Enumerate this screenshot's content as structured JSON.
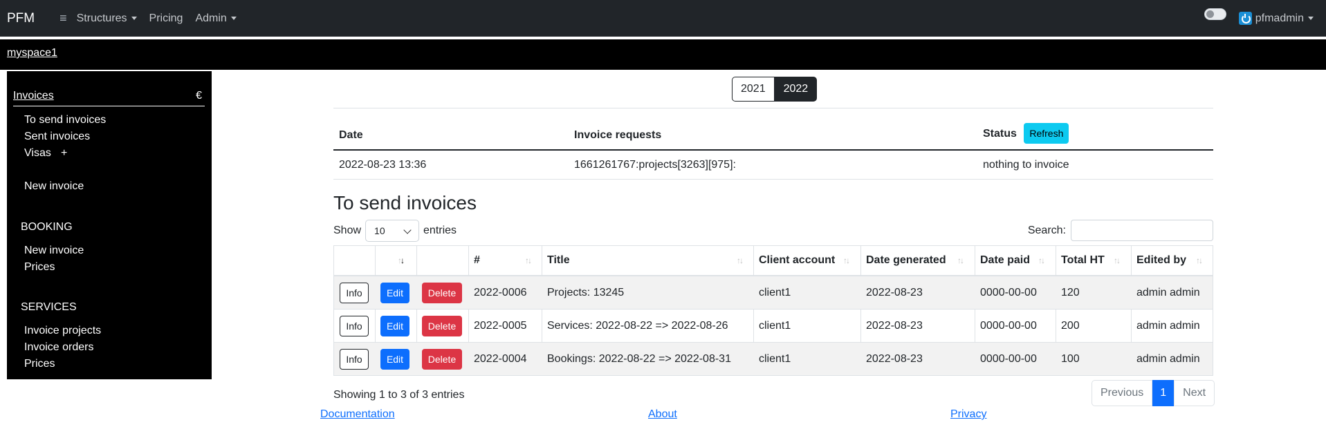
{
  "navbar": {
    "brand": "PFM",
    "menu": [
      {
        "label": "Structures",
        "dropdown": true
      },
      {
        "label": "Pricing",
        "dropdown": false
      },
      {
        "label": "Admin",
        "dropdown": true
      }
    ],
    "user": "pfmadmin"
  },
  "space": {
    "name": "myspace1"
  },
  "sidebar": {
    "title": "Invoices",
    "currency": "€",
    "invoice_items": [
      "To send invoices",
      "Sent invoices",
      "Visas"
    ],
    "visas_plus": "+",
    "new_invoice": "New invoice",
    "sections": [
      {
        "title": "BOOKING",
        "items": [
          "New invoice",
          "Prices"
        ]
      },
      {
        "title": "SERVICES",
        "items": [
          "Invoice projects",
          "Invoice orders",
          "Prices"
        ]
      }
    ]
  },
  "years": {
    "options": [
      "2021",
      "2022"
    ],
    "selected": "2022"
  },
  "requests": {
    "headers": {
      "date": "Date",
      "requests": "Invoice requests",
      "status": "Status"
    },
    "refresh_label": "Refresh",
    "rows": [
      {
        "date": "2022-08-23 13:36",
        "request": "1661261767:projects[3263][975]:",
        "status": "nothing to invoice"
      }
    ]
  },
  "invoices": {
    "title": "To send invoices",
    "show_label": "Show",
    "entries_label": "entries",
    "page_size": "10",
    "search_label": "Search:",
    "search_value": "",
    "columns": [
      "#",
      "Title",
      "Client account",
      "Date generated",
      "Date paid",
      "Total HT",
      "Edited by"
    ],
    "action_labels": {
      "info": "Info",
      "edit": "Edit",
      "delete": "Delete"
    },
    "rows": [
      {
        "num": "2022-0006",
        "title": "Projects: 13245",
        "client": "client1",
        "generated": "2022-08-23",
        "paid": "0000-00-00",
        "total": "120",
        "editor": "admin admin"
      },
      {
        "num": "2022-0005",
        "title": "Services: 2022-08-22 => 2022-08-26",
        "client": "client1",
        "generated": "2022-08-23",
        "paid": "0000-00-00",
        "total": "200",
        "editor": "admin admin"
      },
      {
        "num": "2022-0004",
        "title": "Bookings: 2022-08-22 => 2022-08-31",
        "client": "client1",
        "generated": "2022-08-23",
        "paid": "0000-00-00",
        "total": "100",
        "editor": "admin admin"
      }
    ],
    "info_text": "Showing 1 to 3 of 3 entries",
    "pagination": {
      "previous": "Previous",
      "current": "1",
      "next": "Next"
    }
  },
  "footer": {
    "links": [
      "Documentation",
      "About",
      "Privacy"
    ]
  },
  "colors": {
    "navbar": "#212529",
    "primary": "#0d6efd",
    "danger": "#dc3545",
    "info": "#0dcaf0"
  }
}
